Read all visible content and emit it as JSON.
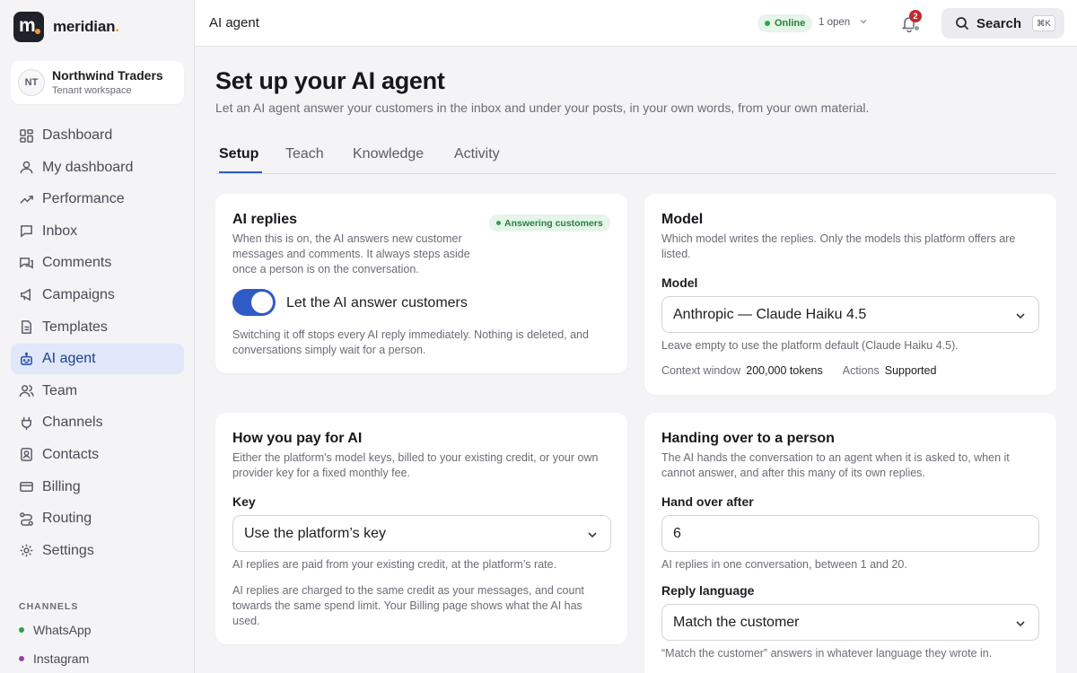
{
  "brand": {
    "name": "meridian",
    "accent": ".",
    "mark": "m"
  },
  "workspace": {
    "initials": "NT",
    "name": "Northwind Traders",
    "subtitle": "Tenant workspace"
  },
  "sidebar": {
    "items": [
      {
        "label": "Dashboard",
        "icon": "grid-icon"
      },
      {
        "label": "My dashboard",
        "icon": "user-icon"
      },
      {
        "label": "Performance",
        "icon": "trend-icon"
      },
      {
        "label": "Inbox",
        "icon": "message-icon"
      },
      {
        "label": "Comments",
        "icon": "comments-icon"
      },
      {
        "label": "Campaigns",
        "icon": "megaphone-icon"
      },
      {
        "label": "Templates",
        "icon": "file-icon"
      },
      {
        "label": "AI agent",
        "icon": "bot-icon",
        "active": true
      },
      {
        "label": "Team",
        "icon": "team-icon"
      },
      {
        "label": "Channels",
        "icon": "plug-icon"
      },
      {
        "label": "Contacts",
        "icon": "contact-icon"
      },
      {
        "label": "Billing",
        "icon": "card-icon"
      },
      {
        "label": "Routing",
        "icon": "route-icon"
      },
      {
        "label": "Settings",
        "icon": "gear-icon"
      }
    ],
    "channels_heading": "CHANNELS",
    "channels": [
      {
        "label": "WhatsApp",
        "color": "#2e9e4f"
      },
      {
        "label": "Instagram",
        "color": "#9b3fb0"
      }
    ]
  },
  "topbar": {
    "title": "AI agent",
    "status": "Online",
    "open_count": "1 open",
    "notifications": "2",
    "search_label": "Search",
    "search_shortcut": "⌘K"
  },
  "page": {
    "title": "Set up your AI agent",
    "subtitle": "Let an AI agent answer your customers in the inbox and under your posts, in your own words, from your own material.",
    "tabs": [
      "Setup",
      "Teach",
      "Knowledge",
      "Activity"
    ],
    "active_tab": "Setup"
  },
  "ai_replies": {
    "title": "AI replies",
    "badge": "Answering customers",
    "description": "When this is on, the AI answers new customer messages and comments. It always steps aside once a person is on the conversation.",
    "toggle_label": "Let the AI answer customers",
    "toggle_on": true,
    "note": "Switching it off stops every AI reply immediately. Nothing is deleted, and conversations simply wait for a person."
  },
  "model_card": {
    "title": "Model",
    "description": "Which model writes the replies. Only the models this platform offers are listed.",
    "field_label": "Model",
    "selected": "Anthropic — Claude Haiku 4.5",
    "help": "Leave empty to use the platform default (Claude Haiku 4.5).",
    "context_label": "Context window",
    "context_value": "200,000 tokens",
    "actions_label": "Actions",
    "actions_value": "Supported"
  },
  "payment_card": {
    "title": "How you pay for AI",
    "description": "Either the platform's model keys, billed to your existing credit, or your own provider key for a fixed monthly fee.",
    "field_label": "Key",
    "selected": "Use the platform’s key",
    "help": "AI replies are paid from your existing credit, at the platform’s rate.",
    "note": "AI replies are charged to the same credit as your messages, and count towards the same spend limit. Your Billing page shows what the AI has used."
  },
  "handover_card": {
    "title": "Handing over to a person",
    "description": "The AI hands the conversation to an agent when it is asked to, when it cannot answer, and after this many of its own replies.",
    "field_label": "Hand over after",
    "value": "6",
    "help": "AI replies in one conversation, between 1 and 20.",
    "language_label": "Reply language",
    "language_selected": "Match the customer",
    "language_help": "“Match the customer” answers in whatever language they wrote in."
  },
  "colors": {
    "accent": "#2f5bc4",
    "success": "#2ea44f",
    "alert": "#c4282d"
  }
}
